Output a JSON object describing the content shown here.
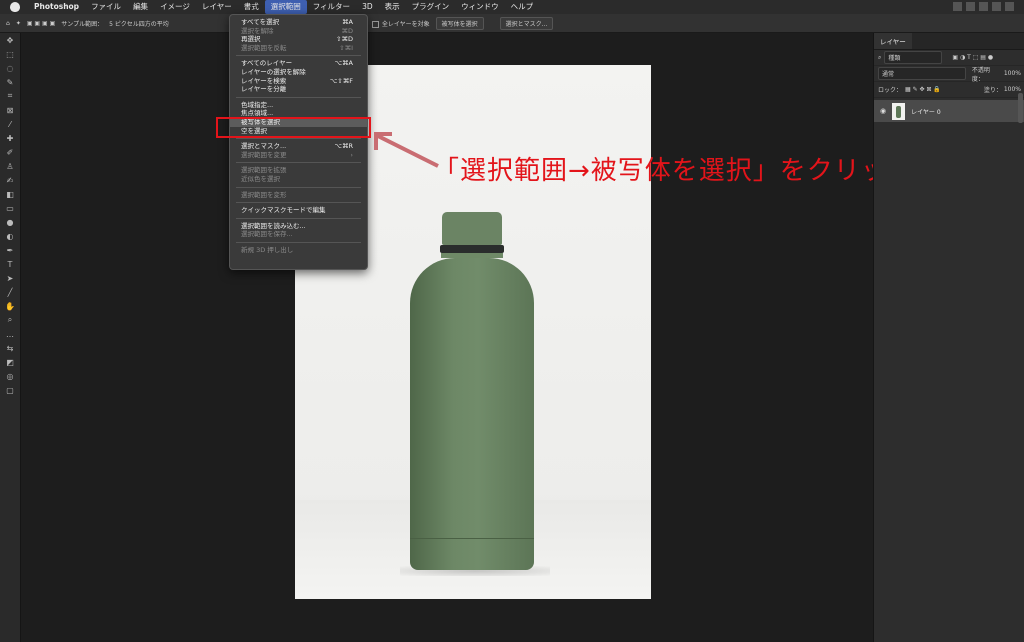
{
  "menubar": {
    "app_name": "Photoshop",
    "items": [
      "ファイル",
      "編集",
      "イメージ",
      "レイヤー",
      "書式",
      "選択範囲",
      "フィルター",
      "3D",
      "表示",
      "プラグイン",
      "ウィンドウ",
      "ヘルプ"
    ],
    "active_item": "選択範囲"
  },
  "options_bar": {
    "sample_label": "サンプル範囲：",
    "sample_value": "5 ピクセル四方の平均",
    "contiguous": "隣接",
    "all_layers": "全レイヤーを対象",
    "select_subject_button": "被写体を選択",
    "select_mask_button": "選択とマスク..."
  },
  "toolbar": {
    "tools": [
      "move-tool",
      "marquee-tool",
      "lasso-tool",
      "quick-select-tool",
      "crop-tool",
      "frame-tool",
      "eyedropper-tool",
      "healing-tool",
      "brush-tool",
      "stamp-tool",
      "history-brush-tool",
      "eraser-tool",
      "gradient-tool",
      "blur-tool",
      "dodge-tool",
      "pen-tool",
      "type-tool",
      "path-select-tool",
      "line-tool",
      "hand-tool",
      "zoom-tool",
      "more-tools",
      "swap-colors",
      "color-swatch",
      "quick-mask",
      "screen-mode"
    ]
  },
  "select_menu": {
    "items": [
      {
        "label": "すべてを選択",
        "shortcut": "⌘A",
        "enabled": true
      },
      {
        "label": "選択を解除",
        "shortcut": "⌘D",
        "enabled": false
      },
      {
        "label": "再選択",
        "shortcut": "⇧⌘D",
        "enabled": true
      },
      {
        "label": "選択範囲を反転",
        "shortcut": "⇧⌘I",
        "enabled": false
      },
      {
        "separator": true
      },
      {
        "label": "すべてのレイヤー",
        "shortcut": "⌥⌘A",
        "enabled": true
      },
      {
        "label": "レイヤーの選択を解除",
        "shortcut": "",
        "enabled": true
      },
      {
        "label": "レイヤーを検索",
        "shortcut": "⌥⇧⌘F",
        "enabled": true
      },
      {
        "label": "レイヤーを分離",
        "shortcut": "",
        "enabled": true
      },
      {
        "separator": true
      },
      {
        "label": "色域指定...",
        "shortcut": "",
        "enabled": true
      },
      {
        "label": "焦点領域...",
        "shortcut": "",
        "enabled": true
      },
      {
        "label": "被写体を選択",
        "shortcut": "",
        "enabled": true,
        "highlighted": true
      },
      {
        "label": "空を選択",
        "shortcut": "",
        "enabled": true
      },
      {
        "separator": true
      },
      {
        "label": "選択とマスク...",
        "shortcut": "⌥⌘R",
        "enabled": true
      },
      {
        "label": "選択範囲を変更",
        "shortcut": "›",
        "enabled": false
      },
      {
        "separator": true
      },
      {
        "label": "選択範囲を拡張",
        "shortcut": "",
        "enabled": false
      },
      {
        "label": "近似色を選択",
        "shortcut": "",
        "enabled": false
      },
      {
        "separator": true
      },
      {
        "label": "選択範囲を変形",
        "shortcut": "",
        "enabled": false
      },
      {
        "separator": true
      },
      {
        "label": "クイックマスクモードで編集",
        "shortcut": "",
        "enabled": true
      },
      {
        "separator": true
      },
      {
        "label": "選択範囲を読み込む...",
        "shortcut": "",
        "enabled": true
      },
      {
        "label": "選択範囲を保存...",
        "shortcut": "",
        "enabled": false
      },
      {
        "separator": true
      },
      {
        "label": "新規 3D 押し出し",
        "shortcut": "",
        "enabled": false
      }
    ]
  },
  "annotation": {
    "text": "「選択範囲→被写体を選択」をクリック",
    "color": "#e3141a"
  },
  "layers_panel": {
    "tab_label": "レイヤー",
    "filter_label": "種類",
    "blend_mode": "通常",
    "opacity_label": "不透明度：",
    "opacity_value": "100%",
    "lock_label": "ロック：",
    "fill_label": "塗り：",
    "fill_value": "100%",
    "layers": [
      {
        "name": "レイヤー 0"
      }
    ]
  }
}
